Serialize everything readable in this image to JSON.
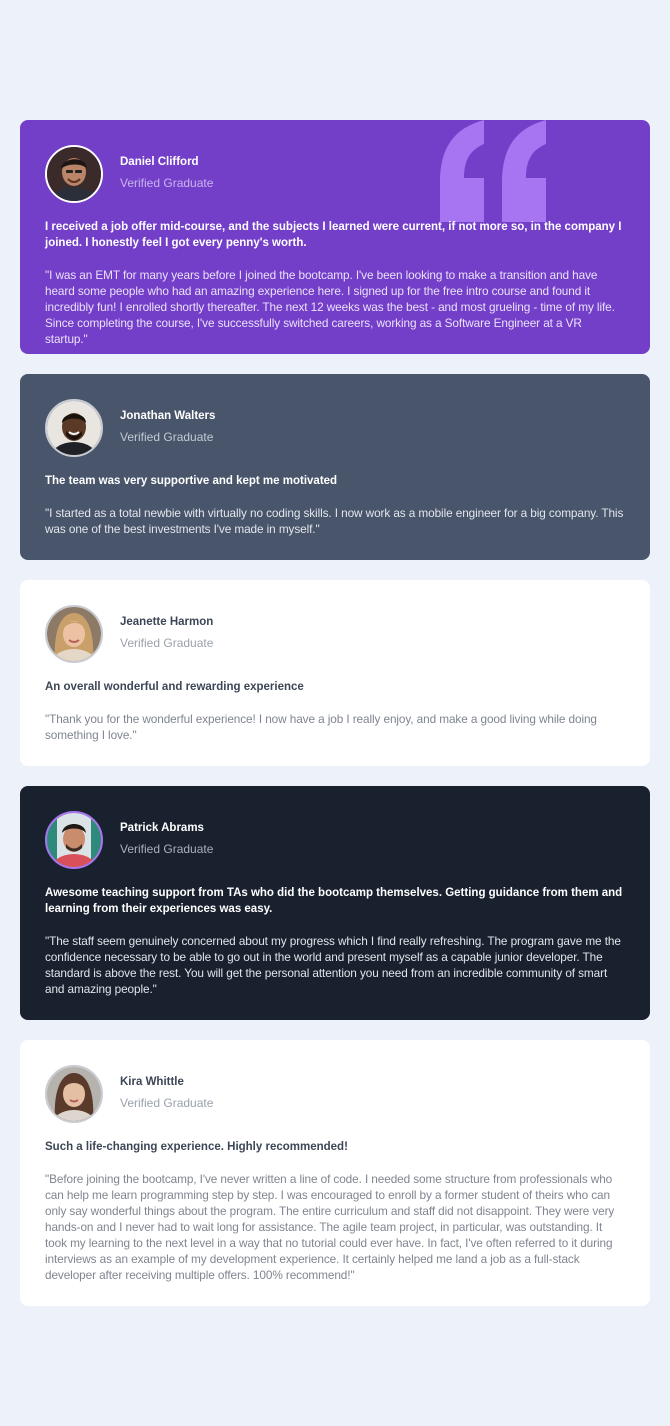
{
  "testimonials": [
    {
      "name": "Daniel Clifford",
      "role": "Verified Graduate",
      "headline": "I received a job offer mid-course, and the subjects I learned were current, if not more so, in the company I joined. I honestly feel I got every penny's worth.",
      "body": "\"I was an EMT for many years before I joined the bootcamp. I've been looking to make a transition and have heard some people who had an amazing experience here. I signed up for the free intro course and found it incredibly fun! I enrolled shortly thereafter. The next 12 weeks was the best - and most grueling - time of my life. Since completing the course, I've successfully switched careers, working as a Software Engineer at a VR startup.\"",
      "bg": "#733FC8"
    },
    {
      "name": "Jonathan Walters",
      "role": "Verified Graduate",
      "headline": "The team was very supportive and kept me motivated",
      "body": "\"I started as a total newbie with virtually no coding skills. I now work as a mobile engineer for a big company. This was one of the best investments I've made in myself.\"",
      "bg": "#48556A"
    },
    {
      "name": "Jeanette Harmon",
      "role": "Verified Graduate",
      "headline": "An overall wonderful and rewarding experience",
      "body": "\"Thank you for the wonderful experience! I now have a job I really enjoy, and make a good living while doing something I love.\"",
      "bg": "#FFFFFF"
    },
    {
      "name": "Patrick Abrams",
      "role": "Verified Graduate",
      "headline": "Awesome teaching support from TAs who did the bootcamp themselves. Getting guidance from them and learning from their experiences was easy.",
      "body": "\"The staff seem genuinely concerned about my progress which I find really refreshing. The program gave me the confidence necessary to be able to go out in the world and present myself as a capable junior developer. The standard is above the rest. You will get the personal attention you need from an incredible community of smart and amazing people.\"",
      "bg": "#19212E"
    },
    {
      "name": "Kira Whittle",
      "role": "Verified Graduate",
      "headline": "Such a life-changing experience. Highly recommended!",
      "body": "\"Before joining the bootcamp, I've never written a line of code. I needed some structure from professionals who can help me learn programming step by step. I was encouraged to enroll by a former student of theirs who can only say wonderful things about the program. The entire curriculum and staff did not disappoint. They were very hands-on and I never had to wait long for assistance. The agile team project, in particular, was outstanding. It took my learning to the next level in a way that no tutorial could ever have. In fact, I've often referred to it during interviews as an example of my development experience. It certainly helped me land a job as a full-stack developer after receiving multiple offers. 100% recommend!\"",
      "bg": "#FFFFFF"
    }
  ],
  "colors": {
    "page_bg": "#ECF1FA",
    "quote_accent": "#A775F1"
  },
  "icons": {
    "quote": "quote-icon",
    "avatar": "avatar-photo"
  }
}
